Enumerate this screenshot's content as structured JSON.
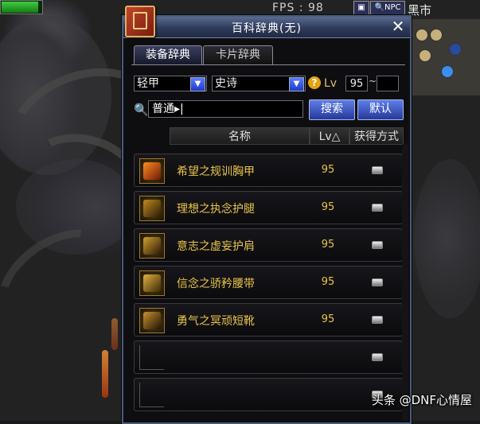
{
  "hud": {
    "fps_label": "FPS : 98",
    "npc_button": "NPC",
    "location": "黑市",
    "hp_fill_fraction": 0.88
  },
  "window": {
    "title": "百科辞典(无)",
    "close_glyph": "✕",
    "tabs": [
      {
        "label": "装备辞典",
        "active": true
      },
      {
        "label": "卡片辞典",
        "active": false
      }
    ],
    "filters": {
      "armor_type": "轻甲",
      "rarity": "史诗",
      "help_glyph": "?",
      "lv_label": "Lv",
      "lv_min": "95",
      "lv_sep": "~",
      "lv_max": ""
    },
    "search": {
      "value": "普通▸|",
      "search_button": "搜索",
      "default_button": "默认"
    },
    "columns": {
      "name": "名称",
      "lv": "Lv△",
      "obtain": "获得方式"
    },
    "items": [
      {
        "name": "希望之规训胸甲",
        "lv": "95",
        "icon": "chest-armor-icon"
      },
      {
        "name": "理想之执念护腿",
        "lv": "95",
        "icon": "leg-armor-icon"
      },
      {
        "name": "意志之虚妄护肩",
        "lv": "95",
        "icon": "shoulder-armor-icon"
      },
      {
        "name": "信念之骄矜腰带",
        "lv": "95",
        "icon": "belt-icon"
      },
      {
        "name": "勇气之冥顽短靴",
        "lv": "95",
        "icon": "boots-icon"
      },
      {
        "name": "",
        "lv": "",
        "icon": ""
      },
      {
        "name": "",
        "lv": "",
        "icon": ""
      }
    ]
  },
  "watermark": "头条 @DNF心情屋",
  "colors": {
    "item_name": "#e8c44a",
    "button_blue": "#3f5ccc",
    "title_bar": "#2e3a5a"
  }
}
